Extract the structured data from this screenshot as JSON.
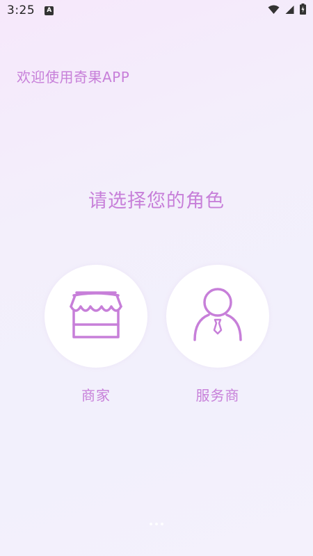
{
  "status_bar": {
    "time": "3:25",
    "notification_badge": "A",
    "icons": [
      "wifi-icon",
      "cell-signal-icon",
      "battery-charging-icon"
    ]
  },
  "welcome_text": "欢迎使用奇果APP",
  "prompt_text": "请选择您的角色",
  "roles": [
    {
      "label": "商家",
      "icon": "storefront-icon"
    },
    {
      "label": "服务商",
      "icon": "person-with-tie-icon"
    }
  ],
  "colors": {
    "accent": "#c77fd9",
    "background": "#f3effb",
    "card": "#ffffff"
  }
}
